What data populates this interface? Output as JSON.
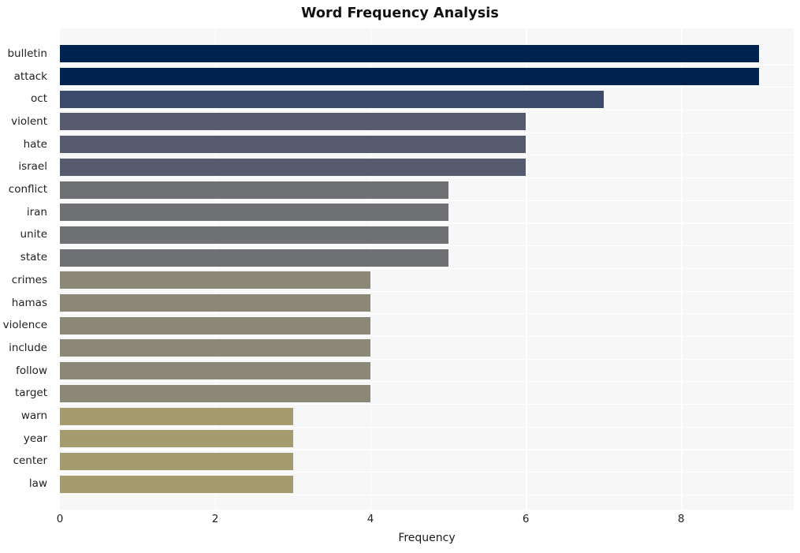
{
  "chart_data": {
    "type": "bar",
    "orientation": "horizontal",
    "title": "Word Frequency Analysis",
    "xlabel": "Frequency",
    "ylabel": "",
    "xlim": [
      0,
      9.45
    ],
    "xticks": [
      0,
      2,
      4,
      6,
      8
    ],
    "xtick_labels": [
      "0",
      "2",
      "4",
      "6",
      "8"
    ],
    "grid": "vertical-white-on-light-gray",
    "legend": "none",
    "categories": [
      "bulletin",
      "attack",
      "oct",
      "violent",
      "hate",
      "israel",
      "conflict",
      "iran",
      "unite",
      "state",
      "crimes",
      "hamas",
      "violence",
      "include",
      "follow",
      "target",
      "warn",
      "year",
      "center",
      "law"
    ],
    "values": [
      9,
      9,
      7,
      6,
      6,
      6,
      5,
      5,
      5,
      5,
      4,
      4,
      4,
      4,
      4,
      4,
      3,
      3,
      3,
      3
    ],
    "bar_colors": [
      "#00224e",
      "#00224e",
      "#3c4a6b",
      "#575b6e",
      "#575b6e",
      "#575b6e",
      "#6e7073",
      "#6e7073",
      "#6e7073",
      "#6e7073",
      "#8b8878",
      "#8b8878",
      "#8b8878",
      "#8b8878",
      "#8b8878",
      "#8b8878",
      "#a49c6e",
      "#a49c6e",
      "#a49c6e",
      "#a49c6e"
    ],
    "bars": [
      {
        "label": "bulletin",
        "value": 9,
        "color": "#00224e"
      },
      {
        "label": "attack",
        "value": 9,
        "color": "#00224e"
      },
      {
        "label": "oct",
        "value": 7,
        "color": "#3c4a6b"
      },
      {
        "label": "violent",
        "value": 6,
        "color": "#575b6e"
      },
      {
        "label": "hate",
        "value": 6,
        "color": "#575b6e"
      },
      {
        "label": "israel",
        "value": 6,
        "color": "#575b6e"
      },
      {
        "label": "conflict",
        "value": 5,
        "color": "#6e7073"
      },
      {
        "label": "iran",
        "value": 5,
        "color": "#6e7073"
      },
      {
        "label": "unite",
        "value": 5,
        "color": "#6e7073"
      },
      {
        "label": "state",
        "value": 5,
        "color": "#6e7073"
      },
      {
        "label": "crimes",
        "value": 4,
        "color": "#8b8878"
      },
      {
        "label": "hamas",
        "value": 4,
        "color": "#8b8878"
      },
      {
        "label": "violence",
        "value": 4,
        "color": "#8b8878"
      },
      {
        "label": "include",
        "value": 4,
        "color": "#8b8878"
      },
      {
        "label": "follow",
        "value": 4,
        "color": "#8b8878"
      },
      {
        "label": "target",
        "value": 4,
        "color": "#8b8878"
      },
      {
        "label": "warn",
        "value": 3,
        "color": "#a49c6e"
      },
      {
        "label": "year",
        "value": 3,
        "color": "#a49c6e"
      },
      {
        "label": "center",
        "value": 3,
        "color": "#a49c6e"
      },
      {
        "label": "law",
        "value": 3,
        "color": "#a49c6e"
      }
    ],
    "style": {
      "figure_background": "#ffffff",
      "plot_background": "#f7f7f8",
      "gridline_color": "#ffffff",
      "text_color": "#222222",
      "title_color": "#111111"
    }
  }
}
